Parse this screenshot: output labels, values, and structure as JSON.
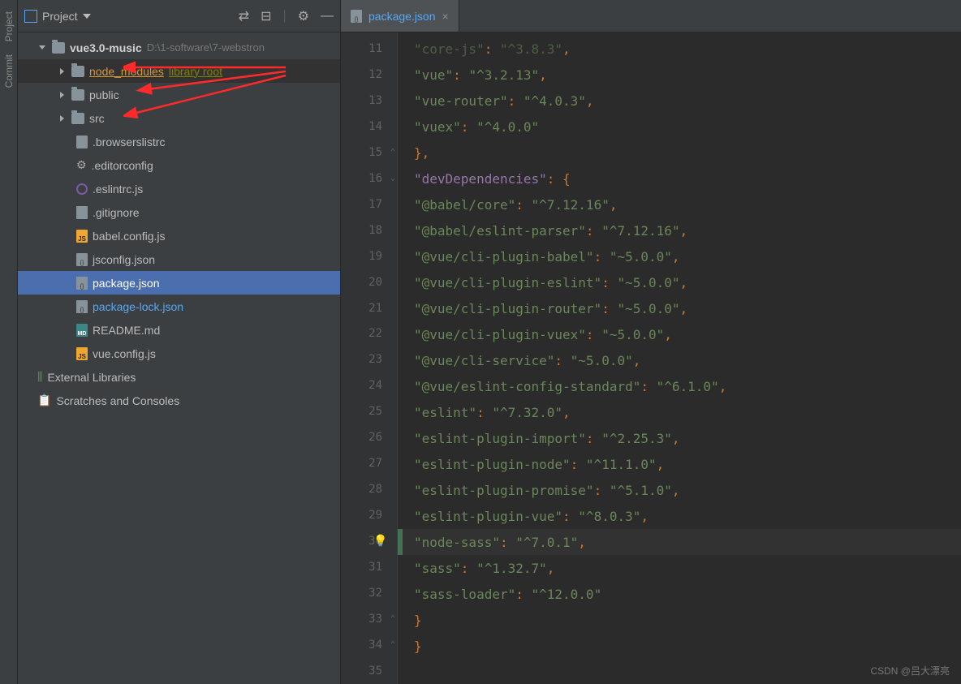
{
  "sidebar": {
    "labels": [
      "Project",
      "Commit"
    ]
  },
  "projectPanel": {
    "title": "Project",
    "tree": {
      "root": {
        "name": "vue3.0-music",
        "path": "D:\\1-software\\7-webstron"
      },
      "folders": [
        {
          "name": "node_modules",
          "suffix": "library root"
        },
        {
          "name": "public"
        },
        {
          "name": "src"
        }
      ],
      "files": [
        {
          "name": ".browserslistrc",
          "icon": "file"
        },
        {
          "name": ".editorconfig",
          "icon": "gear"
        },
        {
          "name": ".eslintrc.js",
          "icon": "circle"
        },
        {
          "name": ".gitignore",
          "icon": "file"
        },
        {
          "name": "babel.config.js",
          "icon": "js"
        },
        {
          "name": "jsconfig.json",
          "icon": "json"
        },
        {
          "name": "package.json",
          "icon": "json",
          "selected": true
        },
        {
          "name": "package-lock.json",
          "icon": "json",
          "blue": true
        },
        {
          "name": "README.md",
          "icon": "md"
        },
        {
          "name": "vue.config.js",
          "icon": "js"
        }
      ],
      "extras": [
        {
          "name": "External Libraries",
          "icon": "lib"
        },
        {
          "name": "Scratches and Consoles",
          "icon": "scratch"
        }
      ]
    }
  },
  "editor": {
    "tab": {
      "name": "package.json"
    },
    "startLine": 11,
    "endLine": 35,
    "currentLine": 30,
    "lines": [
      {
        "n": 11,
        "indent": 4,
        "key": "core-js",
        "val": "^3.8.3",
        "comma": true,
        "faded": true
      },
      {
        "n": 12,
        "indent": 4,
        "key": "vue",
        "val": "^3.2.13",
        "comma": true
      },
      {
        "n": 13,
        "indent": 4,
        "key": "vue-router",
        "val": "^4.0.3",
        "comma": true
      },
      {
        "n": 14,
        "indent": 4,
        "key": "vuex",
        "val": "^4.0.0"
      },
      {
        "n": 15,
        "indent": 2,
        "closing": "},",
        "fold": "close"
      },
      {
        "n": 16,
        "indent": 2,
        "keyOnly": "devDependencies",
        "openBrace": true,
        "purple": true,
        "fold": "open"
      },
      {
        "n": 17,
        "indent": 4,
        "key": "@babel/core",
        "val": "^7.12.16",
        "comma": true
      },
      {
        "n": 18,
        "indent": 4,
        "key": "@babel/eslint-parser",
        "val": "^7.12.16",
        "comma": true
      },
      {
        "n": 19,
        "indent": 4,
        "key": "@vue/cli-plugin-babel",
        "val": "~5.0.0",
        "comma": true
      },
      {
        "n": 20,
        "indent": 4,
        "key": "@vue/cli-plugin-eslint",
        "val": "~5.0.0",
        "comma": true
      },
      {
        "n": 21,
        "indent": 4,
        "key": "@vue/cli-plugin-router",
        "val": "~5.0.0",
        "comma": true
      },
      {
        "n": 22,
        "indent": 4,
        "key": "@vue/cli-plugin-vuex",
        "val": "~5.0.0",
        "comma": true
      },
      {
        "n": 23,
        "indent": 4,
        "key": "@vue/cli-service",
        "val": "~5.0.0",
        "comma": true
      },
      {
        "n": 24,
        "indent": 4,
        "key": "@vue/eslint-config-standard",
        "val": "^6.1.0",
        "comma": true
      },
      {
        "n": 25,
        "indent": 4,
        "key": "eslint",
        "val": "^7.32.0",
        "comma": true
      },
      {
        "n": 26,
        "indent": 4,
        "key": "eslint-plugin-import",
        "val": "^2.25.3",
        "comma": true
      },
      {
        "n": 27,
        "indent": 4,
        "key": "eslint-plugin-node",
        "val": "^11.1.0",
        "comma": true
      },
      {
        "n": 28,
        "indent": 4,
        "key": "eslint-plugin-promise",
        "val": "^5.1.0",
        "comma": true
      },
      {
        "n": 29,
        "indent": 4,
        "key": "eslint-plugin-vue",
        "val": "^8.0.3",
        "comma": true
      },
      {
        "n": 30,
        "indent": 4,
        "key": "node-sass",
        "val": "^7.0.1",
        "comma": true,
        "current": true,
        "bulb": true,
        "green": true
      },
      {
        "n": 31,
        "indent": 4,
        "key": "sass",
        "val": "^1.32.7",
        "comma": true
      },
      {
        "n": 32,
        "indent": 4,
        "key": "sass-loader",
        "val": "^12.0.0"
      },
      {
        "n": 33,
        "indent": 2,
        "closing": "}",
        "fold": "close"
      },
      {
        "n": 34,
        "indent": 0,
        "closing": "}",
        "fold": "close"
      },
      {
        "n": 35,
        "indent": 0,
        "empty": true
      }
    ]
  },
  "watermark": "CSDN @吕大漂亮"
}
